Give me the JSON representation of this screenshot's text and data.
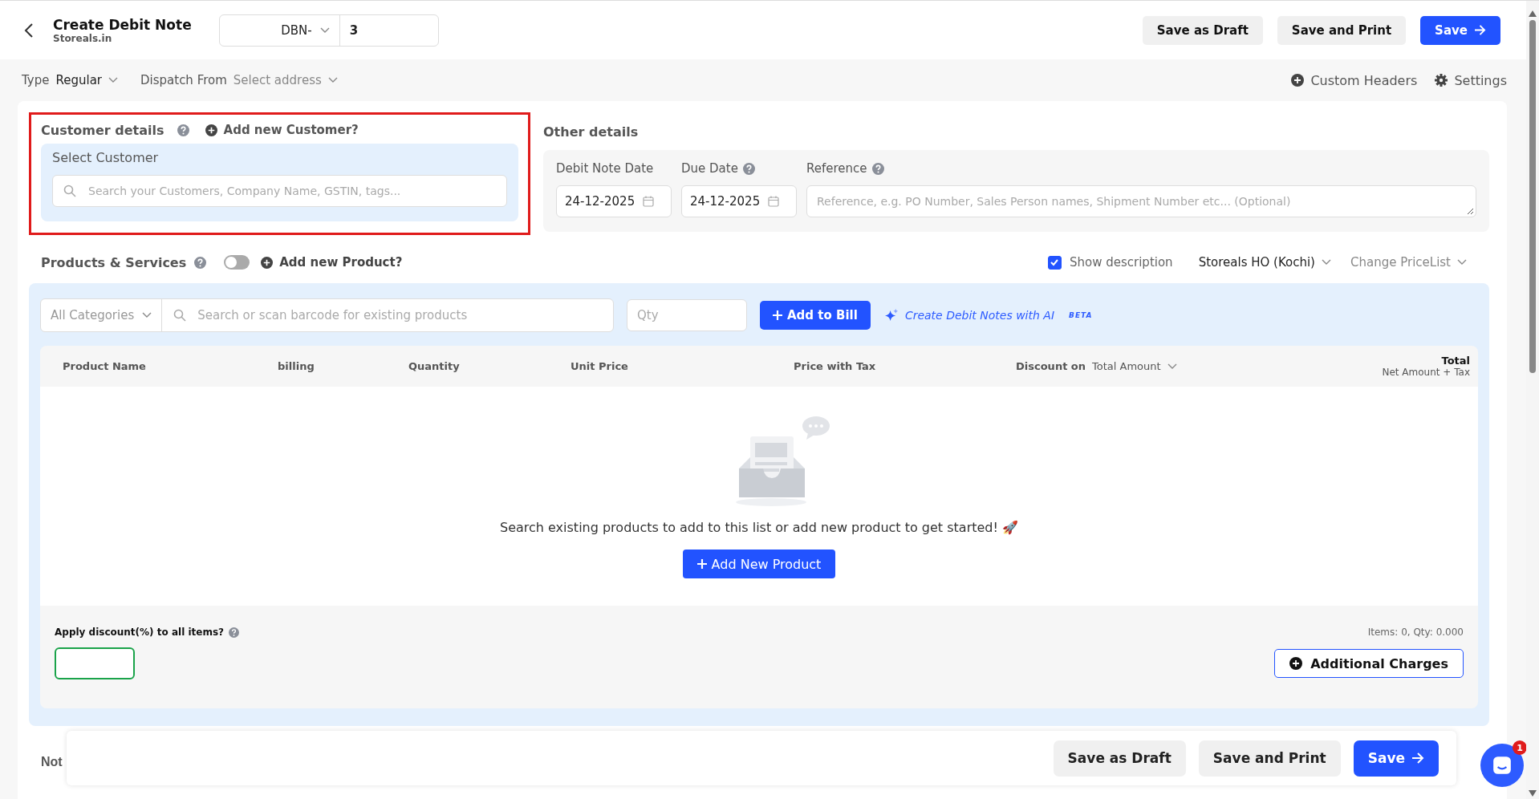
{
  "header": {
    "title": "Create Debit Note",
    "subtitle": "Storeals.in",
    "prefix": "DBN-",
    "number": "3",
    "actions": [
      {
        "label": "Save as Draft",
        "kind": "secondary"
      },
      {
        "label": "Save and Print",
        "kind": "secondary"
      },
      {
        "label": "Save",
        "kind": "primary"
      }
    ]
  },
  "filters": {
    "type_label": "Type",
    "type_value": "Regular",
    "dispatch_label": "Dispatch From",
    "dispatch_placeholder": "Select address",
    "links": [
      {
        "label": "Custom Headers",
        "kind": "plus"
      },
      {
        "label": "Settings",
        "kind": "gear"
      }
    ]
  },
  "customer": {
    "title": "Customer details",
    "add_link": "Add new Customer?",
    "highlighted": true,
    "select_label": "Select Customer",
    "search_placeholder": "Search your Customers, Company Name, GSTIN, tags..."
  },
  "other_details": {
    "title": "Other details",
    "fields": [
      {
        "label": "Debit Note Date",
        "value": "24-12-2025",
        "kind": "date",
        "help": false
      },
      {
        "label": "Due Date",
        "value": "24-12-2025",
        "kind": "date",
        "help": true
      },
      {
        "label": "Reference",
        "placeholder": "Reference, e.g. PO Number, Sales Person names, Shipment Number etc... (Optional)",
        "kind": "text",
        "help": true
      }
    ]
  },
  "products": {
    "title": "Products & Services",
    "toggle_on": false,
    "add_link": "Add new Product?",
    "show_description": {
      "label": "Show description",
      "checked": true
    },
    "warehouse": "Storeals HO (Kochi)",
    "pricelist": "Change PriceList",
    "category": "All Categories",
    "search_placeholder": "Search or scan barcode for existing products",
    "qty_placeholder": "Qty",
    "add_button": "Add to Bill",
    "ai_link": "Create Debit Notes with AI",
    "ai_badge": "BETA",
    "columns": [
      {
        "label": "Product Name"
      },
      {
        "label": "billing"
      },
      {
        "label": "Quantity"
      },
      {
        "label": "Unit Price"
      },
      {
        "label": "Price with Tax"
      },
      {
        "label": "Discount on",
        "dropdown": "Total Amount"
      },
      {
        "label": "Total",
        "sub": "Net Amount + Tax"
      }
    ],
    "empty_text": "Search existing products to add to this list or add new product to get started! 🚀",
    "empty_button": "Add New Product",
    "discount_label": "Apply discount(%) to all items?",
    "summary": "Items: 0, Qty: 0.000",
    "charges_button": "Additional Charges"
  },
  "notes_label": "Not",
  "footer": {
    "actions": [
      {
        "label": "Save as Draft",
        "kind": "secondary"
      },
      {
        "label": "Save and Print",
        "kind": "secondary"
      },
      {
        "label": "Save",
        "kind": "primary"
      }
    ]
  },
  "chat": {
    "badge": "1"
  }
}
